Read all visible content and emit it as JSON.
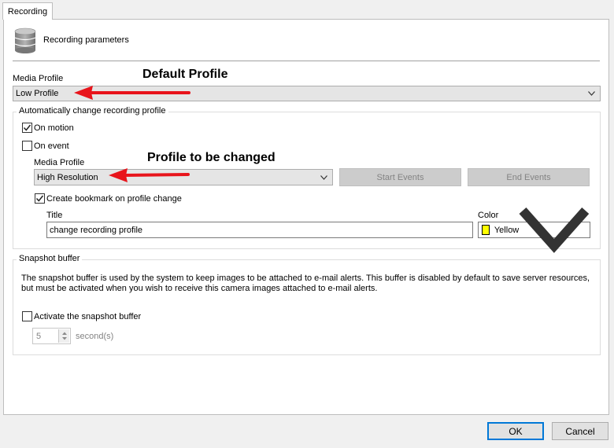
{
  "tab": {
    "label": "Recording"
  },
  "header": {
    "title": "Recording parameters",
    "icon": "database-icon"
  },
  "media_profile": {
    "label": "Media Profile",
    "value": "Low Profile"
  },
  "auto_change": {
    "title": "Automatically change recording profile",
    "on_motion": {
      "label": "On motion",
      "checked": true
    },
    "on_event": {
      "label": "On event",
      "checked": false
    },
    "media_profile_label": "Media Profile",
    "media_profile_value": "High Resolution",
    "start_events": "Start Events",
    "end_events": "End Events",
    "bookmark": {
      "label": "Create bookmark on profile change",
      "checked": true
    },
    "title_label": "Title",
    "title_value": "change recording profile",
    "color_label": "Color",
    "color_value": "Yellow",
    "color_swatch": "#ffff00"
  },
  "snapshot": {
    "title": "Snapshot buffer",
    "description": "The snapshot buffer is used by the system to keep images to be attached to e-mail alerts. This buffer is disabled by default to save server resources, but must be activated when you wish to receive this camera images attached to e-mail alerts.",
    "activate": {
      "label": "Activate the snapshot buffer",
      "checked": false
    },
    "seconds_value": "5",
    "seconds_unit": "second(s)"
  },
  "annotations": {
    "default_profile": "Default Profile",
    "profile_changed": "Profile to be changed",
    "arrow_color": "#e8141b"
  },
  "footer": {
    "ok": "OK",
    "cancel": "Cancel"
  }
}
